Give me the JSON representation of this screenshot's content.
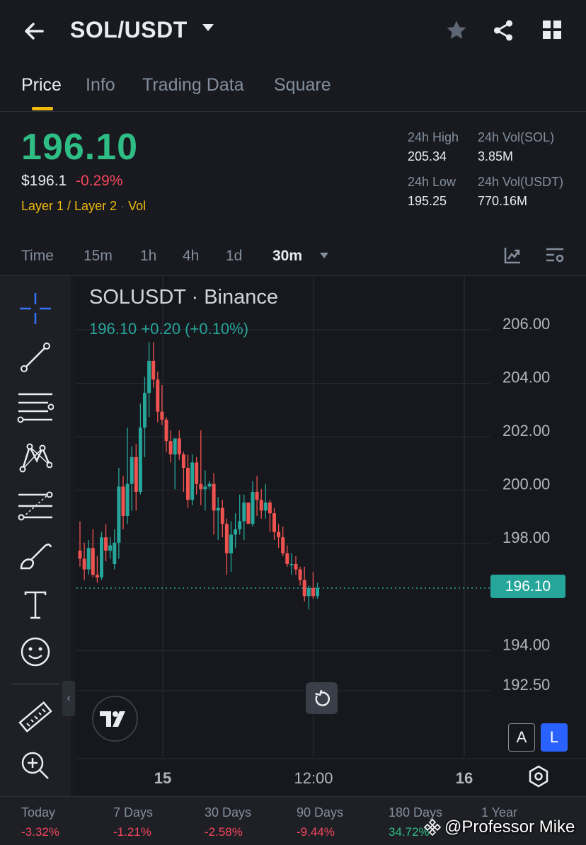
{
  "header": {
    "pair": "SOL/USDT",
    "icons": [
      "back-arrow-icon",
      "chevron-down-icon",
      "star-icon",
      "share-icon",
      "grid-menu-icon"
    ]
  },
  "tabs": [
    {
      "label": "Price",
      "active": true
    },
    {
      "label": "Info",
      "active": false
    },
    {
      "label": "Trading Data",
      "active": false
    },
    {
      "label": "Square",
      "active": false
    }
  ],
  "price": {
    "last": "196.10",
    "usd": "$196.1",
    "change_pct": "-0.29%",
    "tag1": "Layer 1 / Layer 2",
    "tag2": "Vol"
  },
  "stats": {
    "high_label": "24h High",
    "high_value": "205.34",
    "low_label": "24h Low",
    "low_value": "195.25",
    "vol_sol_label": "24h Vol(SOL)",
    "vol_sol_value": "3.85M",
    "vol_usdt_label": "24h Vol(USDT)",
    "vol_usdt_value": "770.16M"
  },
  "timeframes": {
    "items": [
      "Time",
      "15m",
      "1h",
      "4h",
      "1d"
    ],
    "selected": "30m"
  },
  "chart": {
    "ticker": "SOLUSDT · Binance",
    "ohlc_line": "196.10  +0.20 (+0.10%)",
    "price_axis": [
      "206.00",
      "204.00",
      "202.00",
      "200.00",
      "198.00",
      "194.00",
      "192.50"
    ],
    "time_axis": [
      "15",
      "12:00",
      "16"
    ],
    "current_price": "196.10",
    "btn_a": "A",
    "btn_l": "L",
    "up_color": "#26a69a",
    "down_color": "#ef5350"
  },
  "chart_data": {
    "type": "candlestick",
    "candles": [
      [
        197.5,
        198.6,
        196.9,
        197.2
      ],
      [
        197.2,
        197.8,
        196.4,
        196.8
      ],
      [
        196.8,
        197.9,
        196.6,
        197.6
      ],
      [
        197.6,
        198.3,
        196.5,
        196.6
      ],
      [
        196.6,
        197.3,
        196.3,
        196.5
      ],
      [
        196.5,
        198.2,
        196.4,
        198.0
      ],
      [
        198.0,
        198.5,
        197.1,
        197.5
      ],
      [
        197.5,
        198.0,
        197.2,
        197.7
      ],
      [
        197.0,
        198.3,
        196.8,
        197.8
      ],
      [
        197.8,
        200.6,
        197.2,
        199.9
      ],
      [
        199.9,
        200.3,
        198.3,
        198.8
      ],
      [
        198.8,
        202.1,
        198.5,
        200.0
      ],
      [
        200.0,
        201.4,
        199.0,
        201.0
      ],
      [
        201.0,
        201.5,
        199.0,
        199.7
      ],
      [
        199.7,
        203.0,
        199.6,
        202.1
      ],
      [
        202.1,
        204.0,
        201.0,
        203.4
      ],
      [
        203.4,
        205.3,
        202.5,
        204.6
      ],
      [
        204.6,
        205.3,
        203.6,
        203.9
      ],
      [
        203.9,
        204.2,
        202.3,
        202.7
      ],
      [
        202.7,
        203.7,
        202.2,
        202.4
      ],
      [
        202.4,
        202.5,
        201.2,
        201.6
      ],
      [
        201.6,
        202.0,
        200.8,
        201.1
      ],
      [
        201.1,
        201.7,
        199.8,
        201.7
      ],
      [
        201.7,
        202.0,
        200.9,
        201.1
      ],
      [
        201.1,
        201.2,
        199.7,
        200.6
      ],
      [
        200.6,
        201.1,
        199.1,
        199.4
      ],
      [
        199.4,
        201.1,
        199.2,
        200.8
      ],
      [
        200.8,
        201.0,
        199.6,
        200.0
      ],
      [
        200.0,
        202.0,
        199.2,
        199.8
      ],
      [
        199.8,
        200.5,
        199.0,
        199.9
      ],
      [
        199.9,
        200.1,
        199.8,
        200.0
      ],
      [
        200.0,
        200.4,
        198.1,
        199.0
      ],
      [
        199.0,
        199.5,
        197.9,
        199.1
      ],
      [
        199.1,
        199.4,
        198.0,
        198.5
      ],
      [
        198.5,
        198.7,
        196.6,
        197.4
      ],
      [
        197.4,
        198.6,
        196.7,
        198.1
      ],
      [
        198.1,
        198.9,
        197.6,
        198.3
      ],
      [
        198.3,
        199.6,
        198.1,
        198.6
      ],
      [
        198.6,
        199.6,
        197.9,
        199.3
      ],
      [
        199.3,
        199.3,
        198.6,
        198.5
      ],
      [
        198.5,
        200.1,
        198.4,
        199.7
      ],
      [
        199.7,
        200.3,
        198.8,
        199.4
      ],
      [
        199.4,
        199.8,
        198.7,
        199.0
      ],
      [
        199.0,
        200.0,
        198.7,
        199.3
      ],
      [
        199.3,
        199.4,
        198.2,
        198.9
      ],
      [
        198.9,
        199.1,
        197.9,
        198.2
      ],
      [
        198.2,
        198.5,
        197.6,
        198.0
      ],
      [
        198.0,
        198.4,
        197.3,
        197.4
      ],
      [
        197.4,
        197.7,
        196.9,
        197.0
      ],
      [
        197.0,
        197.4,
        196.6,
        197.0
      ],
      [
        197.0,
        197.3,
        196.6,
        196.8
      ],
      [
        196.8,
        196.9,
        196.2,
        196.4
      ],
      [
        196.4,
        196.9,
        195.6,
        195.8
      ],
      [
        195.8,
        196.2,
        195.3,
        196.1
      ],
      [
        196.1,
        196.7,
        195.7,
        195.8
      ],
      [
        195.8,
        196.3,
        195.7,
        196.1
      ]
    ],
    "ylim": [
      191.5,
      207.0
    ],
    "current": 196.1
  },
  "performance": [
    {
      "label": "Today",
      "value": "-3.32%",
      "dir": "neg"
    },
    {
      "label": "7 Days",
      "value": "-1.21%",
      "dir": "neg"
    },
    {
      "label": "30 Days",
      "value": "-2.58%",
      "dir": "neg"
    },
    {
      "label": "90 Days",
      "value": "-9.44%",
      "dir": "neg"
    },
    {
      "label": "180 Days",
      "value": "34.72%",
      "dir": "pos"
    },
    {
      "label": "1 Year",
      "value": "",
      "dir": "pos"
    }
  ],
  "watermark": "@Professor Mike"
}
